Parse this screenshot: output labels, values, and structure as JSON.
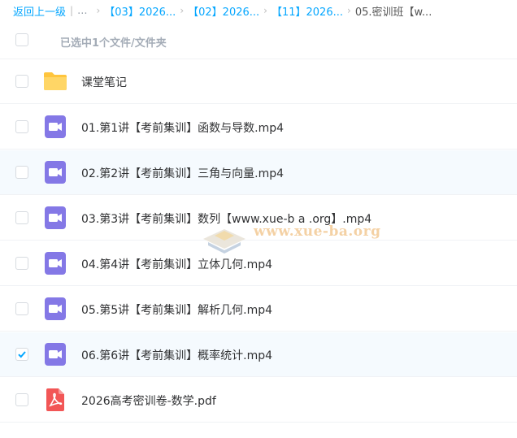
{
  "breadcrumb": {
    "back": "返回上一级",
    "ellipsis": "...",
    "items": [
      "【03】2026...",
      "【02】2026...",
      "【11】2026..."
    ],
    "current": "05.密训班【w..."
  },
  "header": {
    "selected_text": "已选中1个文件/文件夹",
    "select_all_checked": false
  },
  "files": [
    {
      "name": "课堂笔记",
      "type": "folder",
      "checked": false
    },
    {
      "name": "01.第1讲【考前集训】函数与导数.mp4",
      "type": "video",
      "checked": false
    },
    {
      "name": "02.第2讲【考前集训】三角与向量.mp4",
      "type": "video",
      "checked": false
    },
    {
      "name": "03.第3讲【考前集训】数列【www.xue-b a .org】.mp4",
      "type": "video",
      "checked": false
    },
    {
      "name": "04.第4讲【考前集训】立体几何.mp4",
      "type": "video",
      "checked": false
    },
    {
      "name": "05.第5讲【考前集训】解析几何.mp4",
      "type": "video",
      "checked": false
    },
    {
      "name": "06.第6讲【考前集训】概率统计.mp4",
      "type": "video",
      "checked": true
    },
    {
      "name": "2026高考密训卷-数学.pdf",
      "type": "pdf",
      "checked": false
    }
  ],
  "watermark": {
    "text": "www.xue-ba.org"
  },
  "colors": {
    "accent": "#06a7ff",
    "video": "#8478e6",
    "folder": "#ffc53d",
    "pdf": "#f25656",
    "row_highlight": "#f5fafe"
  }
}
